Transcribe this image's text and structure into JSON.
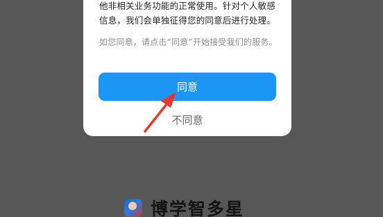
{
  "dialog": {
    "body_text": "他非相关业务功能的正常使用。针对个人敏感信息，我们会单独征得您的同意后进行处理。",
    "hint_text": "如您同意，请点击“同意”开始接受我们的服务。",
    "agree_label": "同意",
    "disagree_label": "不同意"
  },
  "annotation": {
    "arrow_color": "#e8382c"
  },
  "brand": {
    "app_name": "博学智多星",
    "logo_icon": "app-logo-icon"
  },
  "colors": {
    "overlay": "#575757",
    "primary_button": "#1b96f5"
  }
}
